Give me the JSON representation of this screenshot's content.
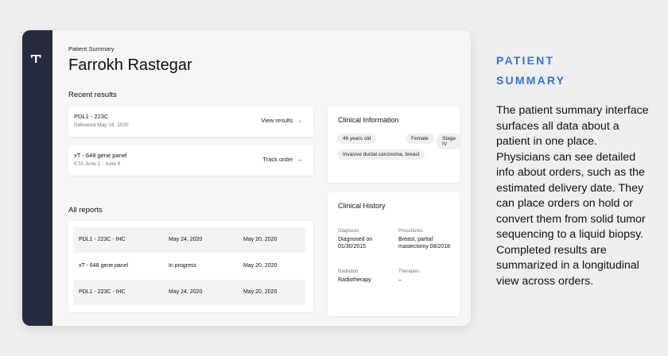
{
  "app": {
    "logo": "'T'",
    "eyebrow": "Patient Summary",
    "patient_name": "Farrokh Rastegar"
  },
  "recent_results": {
    "title": "Recent results",
    "items": [
      {
        "title": "PDL1 - 223C",
        "subtitle": "Delivered May 24, 2020",
        "action": "View results"
      },
      {
        "title": "xT - 648 gene panel",
        "subtitle": "ETA June 2 - June 8",
        "action": "Track order"
      }
    ],
    "arrow_icon": "→"
  },
  "all_reports": {
    "title": "All reports",
    "rows": [
      {
        "name": "PDL1 - 223C - IHC",
        "status": "May 24, 2020",
        "date": "May 20, 2020"
      },
      {
        "name": "xT - 648 gene panel",
        "status": "In progress",
        "date": "May 20, 2020"
      },
      {
        "name": "PDL1 - 223C - IHC",
        "status": "May 24, 2020",
        "date": "May 20, 2020"
      }
    ]
  },
  "clinical_information": {
    "title": "Clinical Information",
    "tags": [
      "46 years old",
      "Female",
      "Stage IV",
      "Invasive ductal carcinoma, breast"
    ]
  },
  "clinical_history": {
    "title": "Clinical History",
    "diagnosis_label": "Diagnosis",
    "diagnosis_value": "Diagnosed on 01/30/2015",
    "procedures_label": "Procedures",
    "procedures_value": "Breast, partial mastectomy 08/2018",
    "radiation_label": "Radiation",
    "radiation_value": "Radiotherapy",
    "therapies_label": "Therapies",
    "therapies_value": "–"
  },
  "side_panel": {
    "heading_line1": "PATIENT",
    "heading_line2": "SUMMARY",
    "body": "The patient summary interface surfaces all data about a patient in one place. Physicians can see detailed info about orders, such as the estimated delivery date. They can place orders on hold or convert them from solid tumor sequencing to a liquid biopsy. Completed results are summarized in a longitudinal view across orders."
  },
  "colors": {
    "rail": "#262a3d",
    "accent": "#2f75d8",
    "background": "#efefef"
  }
}
